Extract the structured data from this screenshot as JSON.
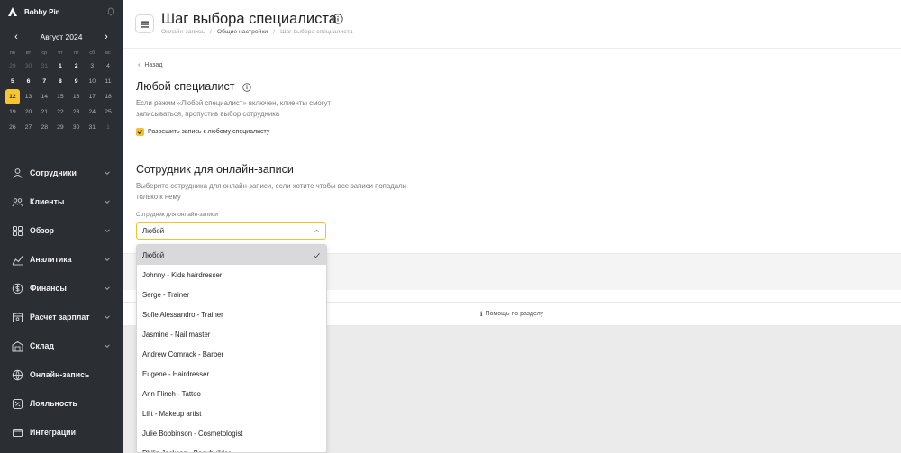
{
  "brand": {
    "name": "Bobby Pin"
  },
  "calendar": {
    "month_label": "Август 2024",
    "weekdays": [
      "пн",
      "вт",
      "ср",
      "чт",
      "пт",
      "сб",
      "вс"
    ],
    "days": [
      {
        "d": "29",
        "s": "dim"
      },
      {
        "d": "30",
        "s": "dim"
      },
      {
        "d": "31",
        "s": "dim"
      },
      {
        "d": "1",
        "s": "bold"
      },
      {
        "d": "2",
        "s": "bold"
      },
      {
        "d": "3",
        "s": ""
      },
      {
        "d": "4",
        "s": ""
      },
      {
        "d": "5",
        "s": "bold"
      },
      {
        "d": "6",
        "s": "bold"
      },
      {
        "d": "7",
        "s": "bold"
      },
      {
        "d": "8",
        "s": "bold"
      },
      {
        "d": "9",
        "s": "bold"
      },
      {
        "d": "10",
        "s": ""
      },
      {
        "d": "11",
        "s": ""
      },
      {
        "d": "12",
        "s": "today"
      },
      {
        "d": "13",
        "s": ""
      },
      {
        "d": "14",
        "s": ""
      },
      {
        "d": "15",
        "s": ""
      },
      {
        "d": "16",
        "s": ""
      },
      {
        "d": "17",
        "s": ""
      },
      {
        "d": "18",
        "s": ""
      },
      {
        "d": "19",
        "s": ""
      },
      {
        "d": "20",
        "s": ""
      },
      {
        "d": "21",
        "s": ""
      },
      {
        "d": "22",
        "s": ""
      },
      {
        "d": "23",
        "s": ""
      },
      {
        "d": "24",
        "s": ""
      },
      {
        "d": "25",
        "s": ""
      },
      {
        "d": "26",
        "s": ""
      },
      {
        "d": "27",
        "s": ""
      },
      {
        "d": "28",
        "s": ""
      },
      {
        "d": "29",
        "s": ""
      },
      {
        "d": "30",
        "s": ""
      },
      {
        "d": "31",
        "s": ""
      },
      {
        "d": "1",
        "s": "dim"
      }
    ]
  },
  "nav": [
    {
      "label": "Сотрудники",
      "icon": "employees-icon",
      "chevron": true
    },
    {
      "label": "Клиенты",
      "icon": "clients-icon",
      "chevron": true
    },
    {
      "label": "Обзор",
      "icon": "overview-icon",
      "chevron": true
    },
    {
      "label": "Аналитика",
      "icon": "analytics-icon",
      "chevron": true
    },
    {
      "label": "Финансы",
      "icon": "finance-icon",
      "chevron": true
    },
    {
      "label": "Расчет зарплат",
      "icon": "payroll-icon",
      "chevron": true
    },
    {
      "label": "Склад",
      "icon": "warehouse-icon",
      "chevron": true
    },
    {
      "label": "Онлайн-запись",
      "icon": "online-booking-icon",
      "chevron": false
    },
    {
      "label": "Лояльность",
      "icon": "loyalty-icon",
      "chevron": false
    },
    {
      "label": "Интеграции",
      "icon": "integrations-icon",
      "chevron": false
    }
  ],
  "header": {
    "title": "Шаг выбора специалиста",
    "breadcrumb": [
      "Онлайн-запись",
      "/",
      "Общие настройки",
      "/",
      "Шаг выбора специалиста"
    ]
  },
  "back_label": "Назад",
  "any_section": {
    "title": "Любой специалист",
    "description": "Если режим «Любой специалист» включен, клиенты смогут записываться, пропустив выбор сотрудника",
    "checkbox_label": "Разрешить запись к любому специалисту",
    "checked": true
  },
  "employee_section": {
    "title": "Сотрудник для онлайн-записи",
    "description": "Выберите сотрудника для онлайн-записи, если хотите чтобы все записи попадали только к нему",
    "field_label": "Сотрудник для онлайн-записи",
    "selected_value": "Любой",
    "options": [
      "Любой",
      "Johnny - Kids hairdresser",
      "Serge - Trainer",
      "Sofie Alessandro - Trainer",
      "Jasmine - Nail master",
      "Andrew Comrack - Barber",
      "Eugene - Hairdresser",
      "Ann Flinch - Tattoo",
      "Lilit - Makeup artist",
      "Julie Bobbinson - Cosmetologist",
      "Philip Jackson - Bodybuilder"
    ]
  },
  "help_label": "Помощь по разделу",
  "colors": {
    "accent": "#f2c12e",
    "sidebar": "#2b2e33"
  }
}
